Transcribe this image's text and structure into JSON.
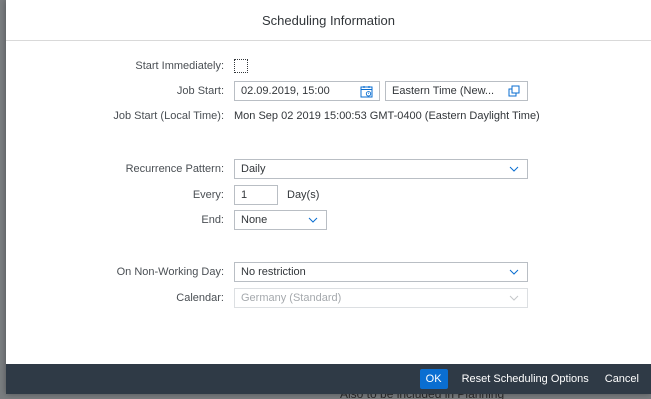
{
  "backdrop": {
    "text": "Also to be included in Planning"
  },
  "dialog": {
    "title": "Scheduling Information",
    "start_immediately": {
      "label": "Start Immediately:",
      "checked": false
    },
    "job_start": {
      "label": "Job Start:",
      "datetime": "02.09.2019, 15:00",
      "timezone": "Eastern Time (New..."
    },
    "job_start_local": {
      "label": "Job Start (Local Time):",
      "value": "Mon Sep 02 2019 15:00:53 GMT-0400 (Eastern Daylight Time)"
    },
    "recurrence": {
      "label": "Recurrence Pattern:",
      "value": "Daily"
    },
    "every": {
      "label": "Every:",
      "value": "1",
      "unit": "Day(s)"
    },
    "end": {
      "label": "End:",
      "value": "None"
    },
    "non_working_day": {
      "label": "On Non-Working Day:",
      "value": "No restriction"
    },
    "calendar": {
      "label": "Calendar:",
      "value": "Germany (Standard)"
    },
    "footer": {
      "ok_label": "OK",
      "reset_label": "Reset Scheduling Options",
      "cancel_label": "Cancel"
    }
  },
  "colors": {
    "primary": "#0a6ed1",
    "footer_bg": "#2f3a46",
    "icon": "#0a6ed1"
  },
  "icons": {
    "calendar": "calendar-icon",
    "value_help": "value-help-icon",
    "dropdown": "chevron-down-icon"
  }
}
